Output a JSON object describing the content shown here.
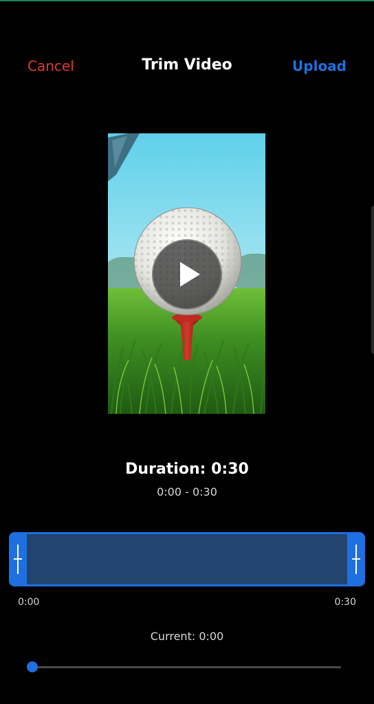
{
  "header": {
    "cancel_label": "Cancel",
    "title": "Trim Video",
    "upload_label": "Upload"
  },
  "video": {
    "thumbnail_subject": "golf ball on red tee in grass",
    "play_icon": "play-icon"
  },
  "trim": {
    "duration_text": "Duration: 0:30",
    "range_text": "0:00 - 0:30",
    "start_label": "0:00",
    "end_label": "0:30",
    "start_fraction": 0,
    "end_fraction": 1
  },
  "playback": {
    "current_text": "Current: 0:00",
    "progress_fraction": 0
  },
  "colors": {
    "cancel": "#e23b2e",
    "upload": "#1e6fe0",
    "accent": "#1e6fe0",
    "trim_window": "#22456f",
    "background": "#000000"
  }
}
